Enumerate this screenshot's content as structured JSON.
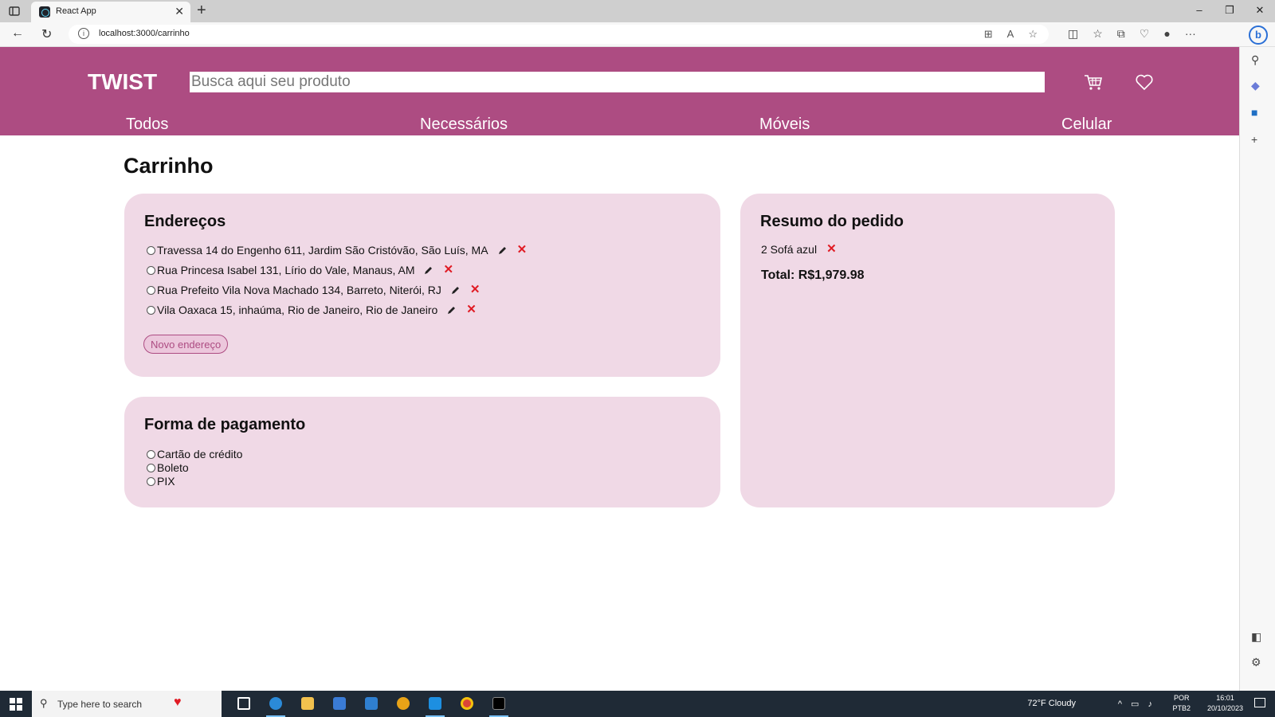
{
  "browser": {
    "tab_title": "React App",
    "url": "localhost:3000/carrinho"
  },
  "header": {
    "logo": "TWIST",
    "search_placeholder": "Busca aqui seu produto",
    "categories": [
      "Todos",
      "Necessários",
      "Móveis",
      "Celular"
    ]
  },
  "page": {
    "title": "Carrinho"
  },
  "addresses": {
    "title": "Endereços",
    "items": [
      "Travessa 14 do Engenho 611, Jardim São Cristóvão, São Luís, MA",
      "Rua Princesa Isabel 131, Lírio do Vale, Manaus, AM",
      "Rua Prefeito Vila Nova Machado 134, Barreto, Niterói, RJ",
      "Vila Oaxaca 15, inhaúma, Rio de Janeiro, Rio de Janeiro"
    ],
    "new_button": "Novo endereço"
  },
  "payment": {
    "title": "Forma de pagamento",
    "options": [
      "Cartão de crédito",
      "Boleto",
      "PIX"
    ]
  },
  "summary": {
    "title": "Resumo do pedido",
    "item": "2 Sofá azul",
    "total": "Total: R$1,979.98"
  },
  "taskbar": {
    "search_placeholder": "Type here to search",
    "weather": "72°F  Cloudy",
    "lang_line1": "POR",
    "lang_line2": "PTB2",
    "time": "16:01",
    "date": "20/10/2023"
  },
  "colors": {
    "brand": "#ad4c82",
    "card_bg": "#f0d9e6",
    "delete": "#e01b24"
  }
}
